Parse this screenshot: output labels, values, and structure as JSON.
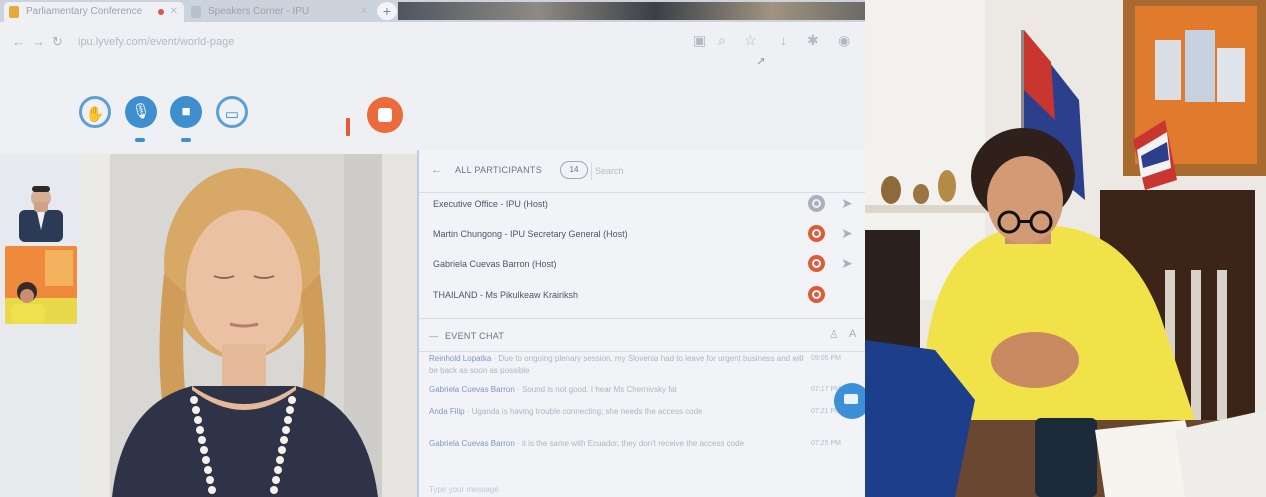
{
  "browser": {
    "tabs": [
      {
        "title": "Parliamentary Conference"
      },
      {
        "title": "Speakers Corner - IPU"
      }
    ],
    "url": "ipu.lyvefy.com/event/world-page"
  },
  "controls": {
    "hand_icon": "raise-hand-icon",
    "mic_icon": "microphone-icon",
    "camera_icon": "camera-icon",
    "share_icon": "screen-share-icon",
    "stop_icon": "stop-icon"
  },
  "participants": {
    "header": "ALL PARTICIPANTS",
    "count": "14",
    "search_placeholder": "Search",
    "rows": [
      {
        "name": "Executive Office - IPU (Host)",
        "status": "grey"
      },
      {
        "name": "Martin Chungong - IPU Secretary General (Host)",
        "status": "red"
      },
      {
        "name": "Gabriela Cuevas Barron (Host)",
        "status": "red"
      },
      {
        "name": "THAILAND - Ms Pikulkeaw Krairiksh",
        "status": "red"
      }
    ]
  },
  "chat": {
    "header": "EVENT CHAT",
    "messages": [
      {
        "sender": "Reinhold Lopatka",
        "text": "Due to ongoing plenary session, my Slovenia had to leave for urgent business and will be back as soon as possible",
        "time": "09:05 PM"
      },
      {
        "sender": "Gabriela Cuevas Barron",
        "text": "Sound is not good. I hear Ms Chernivsky fal",
        "time": "07:17 PM"
      },
      {
        "sender": "Anda Filip",
        "text": "Uganda is having trouble connecting; she needs the access code",
        "time": "07:21 PM"
      },
      {
        "sender": "Gabriela Cuevas Barron",
        "text": "it is the same with Ecuador, they don't receive the access code",
        "time": "07:25 PM"
      }
    ],
    "input_placeholder": "Type your message"
  },
  "colors": {
    "accent_blue": "#3f8fd0",
    "stop_orange": "#ec6a3c",
    "status_red": "#e05a38",
    "room_wall": "#ece8e3",
    "jacket_yellow": "#f2e24a"
  }
}
